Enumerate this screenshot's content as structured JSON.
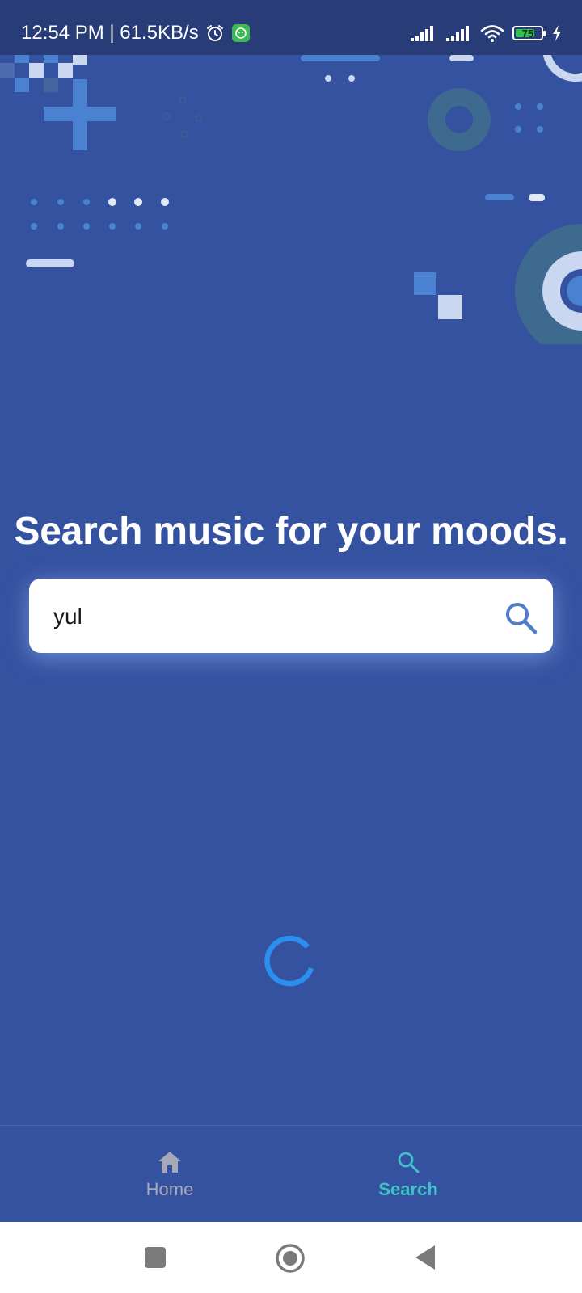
{
  "status_bar": {
    "time_speed": "12:54 PM | 61.5KB/s",
    "battery_level": "75",
    "battery_percent": 75,
    "icons": [
      "alarm-icon",
      "app-notification-icon",
      "signal-icon",
      "signal-icon",
      "wifi-icon",
      "battery-icon",
      "charging-icon"
    ]
  },
  "main": {
    "headline": "Search music for your moods.",
    "search_value": "yul",
    "search_icon": "search-icon",
    "loading": "spinner-icon"
  },
  "bottom_nav": {
    "items": [
      {
        "label": "Home",
        "icon": "home-icon",
        "active": false
      },
      {
        "label": "Search",
        "icon": "search-icon",
        "active": true
      }
    ]
  },
  "system_nav": {
    "buttons": [
      "recents-button",
      "home-button",
      "back-button"
    ]
  },
  "colors": {
    "background": "#3552a1",
    "status_bar": "#283d78",
    "accent_active": "#3fc1c9",
    "inactive": "#a7a9b8",
    "search_icon": "#4f7dc9",
    "spinner": "#2b8ff0"
  }
}
